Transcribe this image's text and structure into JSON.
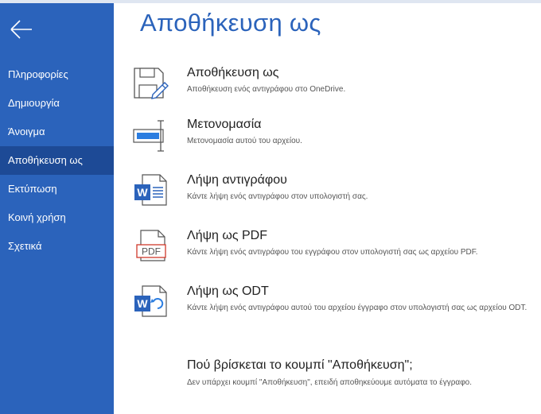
{
  "colors": {
    "accent": "#2b63bb",
    "sidebar_selected": "#1d4a96",
    "pdf_red": "#d0392b"
  },
  "sidebar": {
    "back_icon": "back-arrow-icon",
    "items": [
      {
        "label": "Πληροφορίες"
      },
      {
        "label": "Δημιουργία"
      },
      {
        "label": "Άνοιγμα"
      },
      {
        "label": "Αποθήκευση ως",
        "selected": true
      },
      {
        "label": "Εκτύπωση"
      },
      {
        "label": "Κοινή χρήση"
      },
      {
        "label": "Σχετικά"
      }
    ]
  },
  "main": {
    "title": "Αποθήκευση ως",
    "options": [
      {
        "icon": "save-as-icon",
        "title": "Αποθήκευση ως",
        "desc": "Αποθήκευση ενός αντιγράφου στο OneDrive."
      },
      {
        "icon": "rename-icon",
        "title": "Μετονομασία",
        "desc": "Μετονομασία αυτού του αρχείου."
      },
      {
        "icon": "word-document-icon",
        "title": "Λήψη αντιγράφου",
        "desc": "Κάντε λήψη ενός αντιγράφου στον υπολογιστή σας."
      },
      {
        "icon": "pdf-document-icon",
        "title": "Λήψη ως PDF",
        "desc": "Κάντε λήψη ενός αντιγράφου του εγγράφου στον υπολογιστή σας ως αρχείου PDF.",
        "icon_text": "PDF"
      },
      {
        "icon": "odt-document-icon",
        "title": "Λήψη ως ODT",
        "desc": "Κάντε λήψη ενός αντιγράφου αυτού του αρχείου έγγραφο στον υπολογιστή σας ως αρχείου ODT."
      }
    ],
    "info": {
      "title": "Πού βρίσκεται το κουμπί \"Αποθήκευση\";",
      "desc": "Δεν υπάρχει κουμπί \"Αποθήκευση\", επειδή αποθηκεύουμε αυτόματα το έγγραφο."
    }
  }
}
